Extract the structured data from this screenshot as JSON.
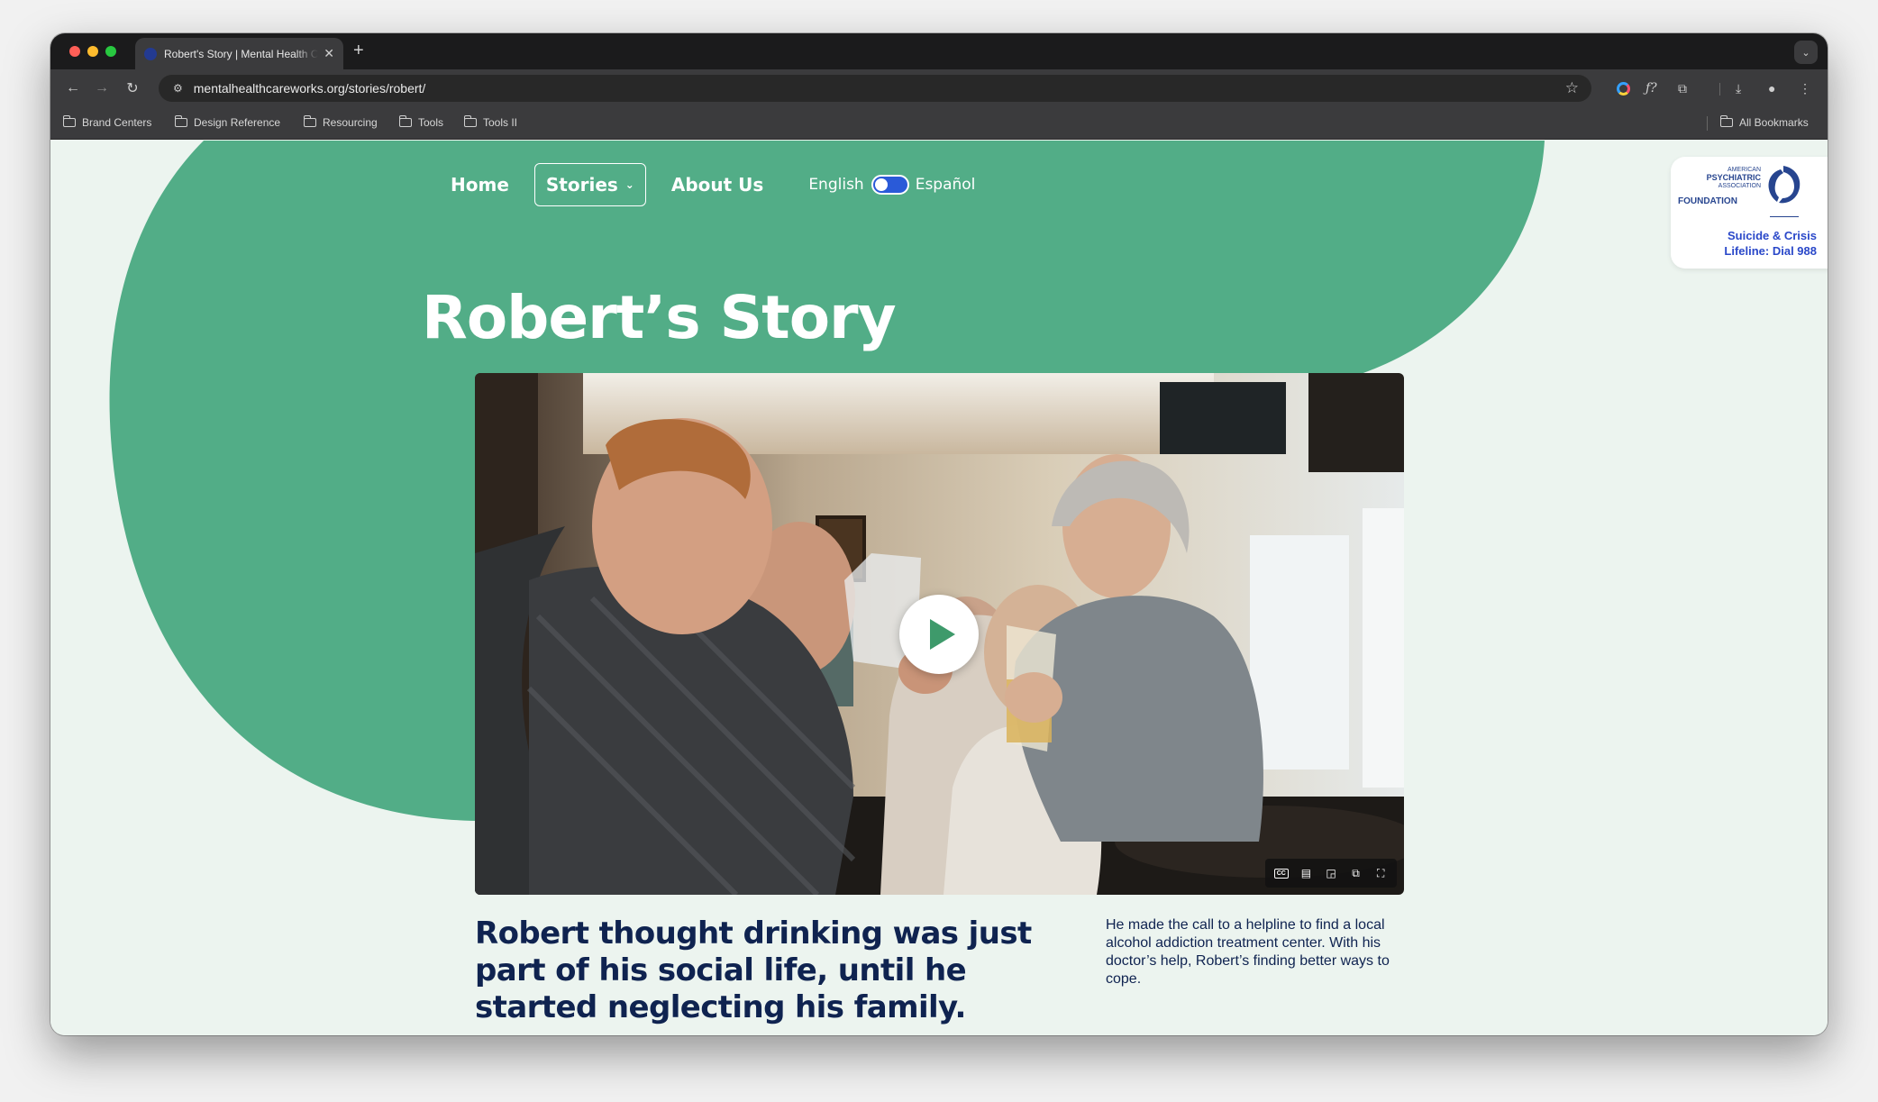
{
  "browser": {
    "tab_title": "Robert's Story | Mental Health Care Works",
    "url": "mentalhealthcareworks.org/stories/robert/",
    "bookmarks": [
      "Brand Centers",
      "Design Reference",
      "Resourcing",
      "Tools",
      "Tools II"
    ],
    "all_bookmarks": "All Bookmarks"
  },
  "nav": {
    "home": "Home",
    "stories": "Stories",
    "about": "About Us",
    "lang_en": "English",
    "lang_es": "Español",
    "lang_selected": "English"
  },
  "badge": {
    "org_line1": "AMERICAN",
    "org_line2": "PSYCHIATRIC",
    "org_line3": "ASSOCIATION",
    "org_line4": "FOUNDATION",
    "crisis": "Suicide & Crisis\nLifeline: Dial 988"
  },
  "story": {
    "title": "Robert’s Story",
    "headline": "Robert thought drinking was just part of his social life, until he started neglecting his family.",
    "summary": "He made the call to a helpline to find a local alcohol addiction treatment center. With his doctor’s help, Robert’s finding better ways to cope."
  },
  "video": {
    "cc_label": "CC"
  },
  "colors": {
    "brand_green": "#52ad87",
    "navy": "#0f2350",
    "page_bg": "#ecf4ef",
    "link_blue": "#2a48c9",
    "play_green": "#3e9a6b"
  }
}
